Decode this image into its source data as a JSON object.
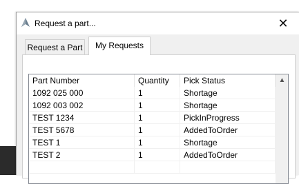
{
  "window": {
    "title": "Request a part...",
    "close_glyph": "✕"
  },
  "tabs": [
    {
      "label": "Request a Part",
      "active": false
    },
    {
      "label": "My Requests",
      "active": true
    }
  ],
  "grid": {
    "columns": [
      "Part Number",
      "Quantity",
      "Pick Status"
    ],
    "rows": [
      [
        "1092 025 000",
        "1",
        "Shortage"
      ],
      [
        "1092 003 002",
        "1",
        "Shortage"
      ],
      [
        "TEST 1234",
        "1",
        "PickInProgress"
      ],
      [
        "TEST 5678",
        "1",
        "AddedToOrder"
      ],
      [
        "TEST 1",
        "1",
        "Shortage"
      ],
      [
        "TEST 2",
        "1",
        "AddedToOrder"
      ]
    ],
    "scroll_up_glyph": "▲"
  },
  "icons": {
    "app": "app-logo-icon",
    "close": "close-icon",
    "scroll_up": "chevron-up-icon"
  }
}
